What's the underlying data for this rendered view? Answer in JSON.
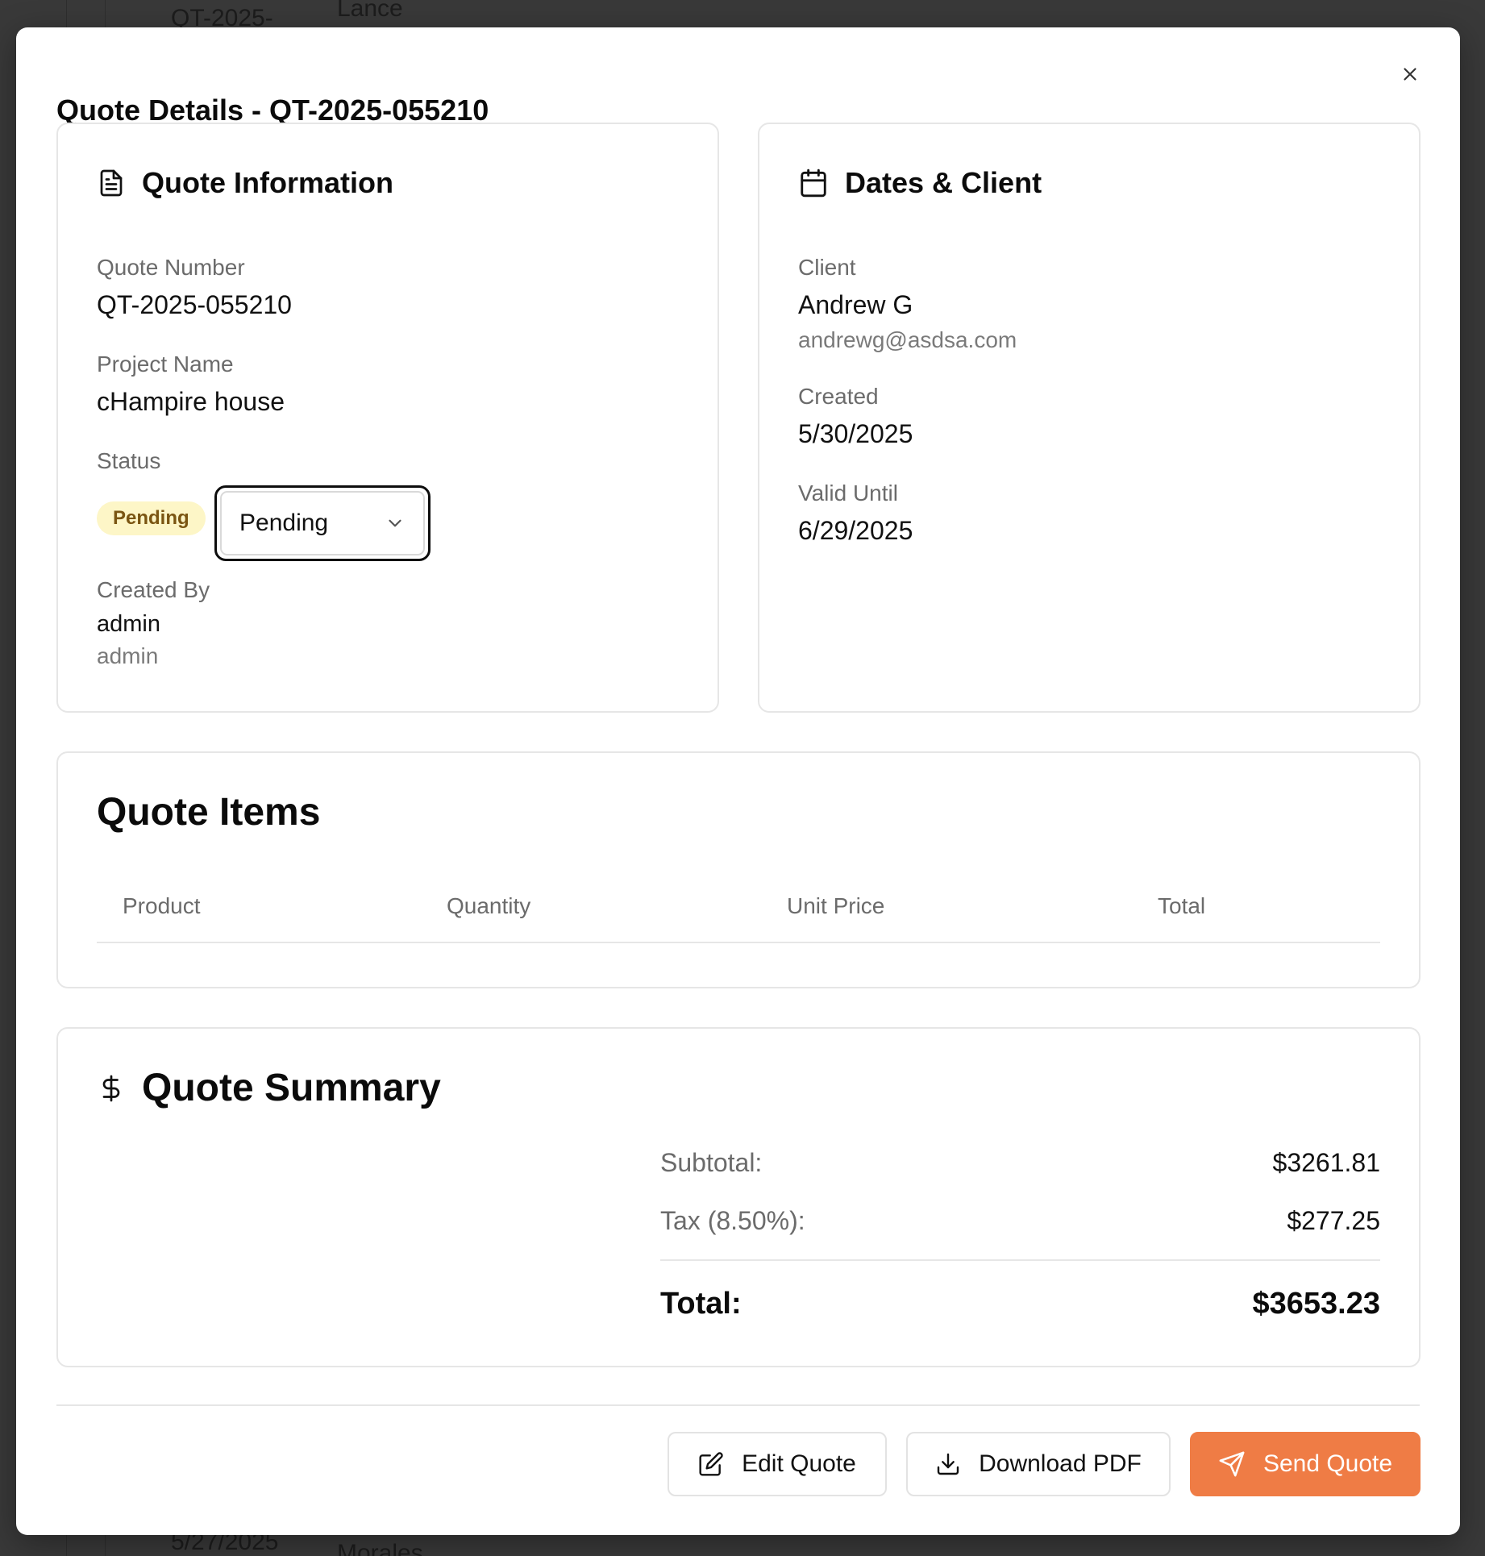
{
  "background": {
    "fragments_top": [
      "QT-2025-",
      "Lance"
    ],
    "fragments_bottom": [
      "5/27/2025",
      "Morales"
    ]
  },
  "modal": {
    "title": "Quote Details - QT-2025-055210",
    "close_icon": "close-icon"
  },
  "quote_info": {
    "heading": "Quote Information",
    "icon": "file-text-icon",
    "quote_number_label": "Quote Number",
    "quote_number": "QT-2025-055210",
    "project_name_label": "Project Name",
    "project_name": "cHampire house",
    "status_label": "Status",
    "status_badge": "Pending",
    "status_select_value": "Pending",
    "created_by_label": "Created By",
    "created_by_name": "admin",
    "created_by_username": "admin"
  },
  "dates_client": {
    "heading": "Dates & Client",
    "icon": "calendar-icon",
    "client_label": "Client",
    "client_name": "Andrew G",
    "client_email": "andrewg@asdsa.com",
    "created_label": "Created",
    "created_date": "5/30/2025",
    "valid_until_label": "Valid Until",
    "valid_until_date": "6/29/2025"
  },
  "quote_items": {
    "heading": "Quote Items",
    "columns": [
      "Product",
      "Quantity",
      "Unit Price",
      "Total"
    ],
    "rows": []
  },
  "summary": {
    "heading": "Quote Summary",
    "icon": "dollar-icon",
    "subtotal_label": "Subtotal:",
    "subtotal_value": "$3261.81",
    "tax_label": "Tax (8.50%):",
    "tax_value": "$277.25",
    "total_label": "Total:",
    "total_value": "$3653.23"
  },
  "actions": {
    "edit_label": "Edit Quote",
    "download_label": "Download PDF",
    "send_label": "Send Quote"
  },
  "colors": {
    "primary": "#ef7c45",
    "badge_bg": "#fdf6c7",
    "badge_text": "#7a5512"
  }
}
